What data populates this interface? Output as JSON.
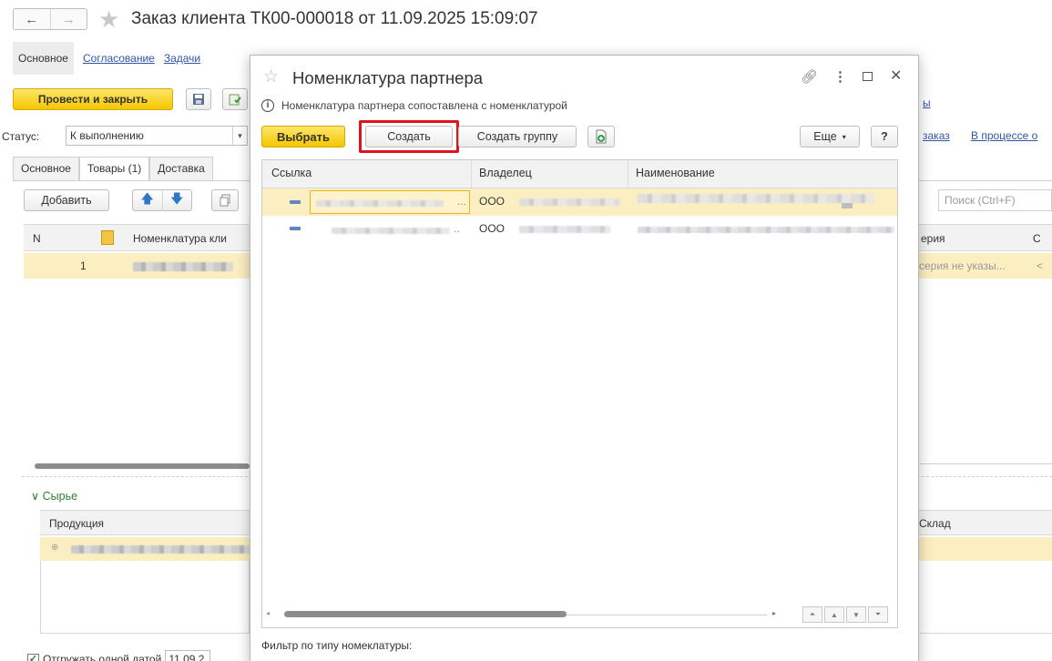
{
  "window": {
    "title": "Заказ клиента ТК00-000018 от 11.09.2025 15:09:07",
    "nav_back": "←",
    "nav_forward": "→",
    "top_tabs": [
      "Основное",
      "Согласование",
      "Задачи"
    ],
    "post_close_label": "Провести и закрыть",
    "status_label": "Статус:",
    "status_value": "К выполнению",
    "right_links": [
      "ы",
      "заказ",
      "В процессе о"
    ],
    "sub_tabs": [
      "Основное",
      "Товары (1)",
      "Доставка"
    ],
    "add_label": "Добавить",
    "search_placeholder": "Поиск (Ctrl+F)",
    "columns": [
      "N",
      "Номенклатура кли",
      "ерия",
      "С"
    ],
    "row": {
      "n": "1",
      "series": "серия не указы...",
      "last": "<"
    },
    "section": "Сырье",
    "section_col1": "Продукция",
    "section_col2": "Склад",
    "footer_checkbox_label": "Отгружать одной датой",
    "footer_date": "11.09.2"
  },
  "dialog": {
    "title": "Номенклатура партнера",
    "info": "Номенклатура партнера сопоставлена с номенклатурой",
    "select_label": "Выбрать",
    "create_label": "Создать",
    "create_group_label": "Создать группу",
    "more_label": "Еще",
    "help_label": "?",
    "columns": [
      "Ссылка",
      "Владелец",
      "Наименование"
    ],
    "rows": [
      {
        "owner": "ООО",
        "ellipsis": "..."
      },
      {
        "owner": "ООО",
        "ellipsis": ".."
      }
    ],
    "filter_label": "Фильтр по типу номеклатуры:",
    "highlight_color": "#e0141a"
  }
}
